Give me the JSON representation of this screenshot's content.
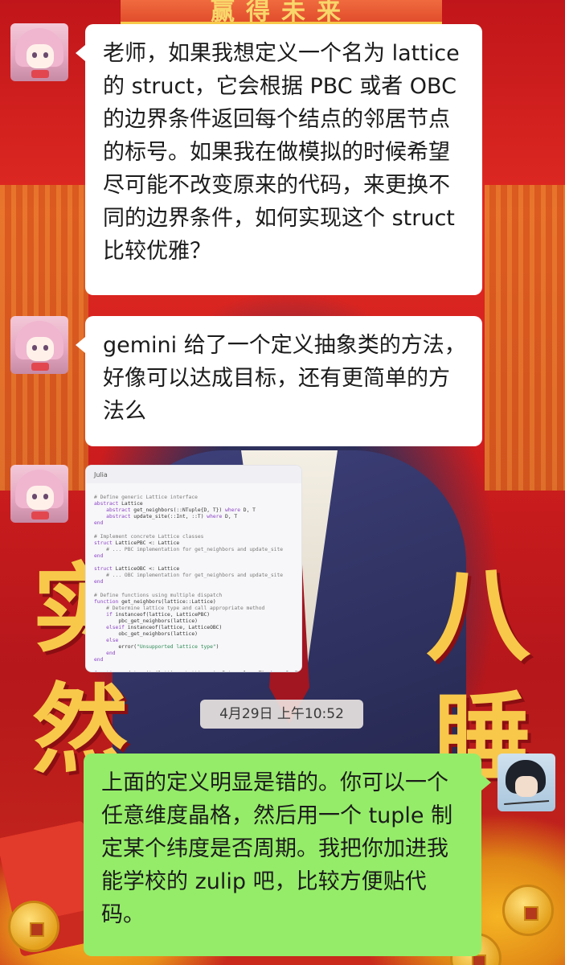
{
  "chat": {
    "messages": [
      {
        "sender": "other",
        "text": "老师，如果我想定义一个名为 lattice 的 struct，它会根据 PBC 或者 OBC 的边界条件返回每个结点的邻居节点的标号。如果我在做模拟的时候希望尽可能不改变原来的代码，来更换不同的边界条件，如何实现这个 struct 比较优雅？"
      },
      {
        "sender": "other",
        "text": "gemini 给了一个定义抽象类的方法，好像可以达成目标，还有更简单的方法么"
      },
      {
        "sender": "other",
        "type": "code-image",
        "language_label": "Julia",
        "code_lines": [
          "",
          "# Define generic Lattice interface",
          "abstract Lattice",
          "    abstract get_neighbors(::NTuple{D, T}) where D, T",
          "    abstract update_site(::Int, ::T) where D, T",
          "end",
          "",
          "# Implement concrete Lattice classes",
          "struct LatticePBC <: Lattice",
          "    # ... PBC implementation for get_neighbors and update_site",
          "end",
          "",
          "struct LatticeOBC <: Lattice",
          "    # ... OBC implementation for get_neighbors and update_site",
          "end",
          "",
          "# Define functions using multiple dispatch",
          "function get_neighbors(lattice::Lattice)",
          "    # Determine lattice type and call appropriate method",
          "    if instanceof(lattice, LatticePBC)",
          "        pbc_get_neighbors(lattice)",
          "    elseif instanceof(lattice, LatticeOBC)",
          "        obc_get_neighbors(lattice)",
          "    else",
          "        error(\"Unsupported lattice type\")",
          "    end",
          "end",
          "",
          "function update_site(lattice::Lattice, i::Int, value::T) where D, T"
        ]
      },
      {
        "sender": "self",
        "text": "上面的定义明显是错的。你可以一个任意维度晶格，然后用一个 tuple 制定某个纬度是否周期。我把你加进我能学校的 zulip 吧，比较方便贴代码。"
      }
    ],
    "timestamp": "4月29日 上午10:52"
  },
  "background": {
    "banner_text": "赢得未来",
    "big_chars": [
      "实",
      "然",
      "八",
      "睡"
    ]
  },
  "colors": {
    "self_bubble": "#95ec69",
    "other_bubble": "#ffffff",
    "background_red": "#c9201d"
  }
}
